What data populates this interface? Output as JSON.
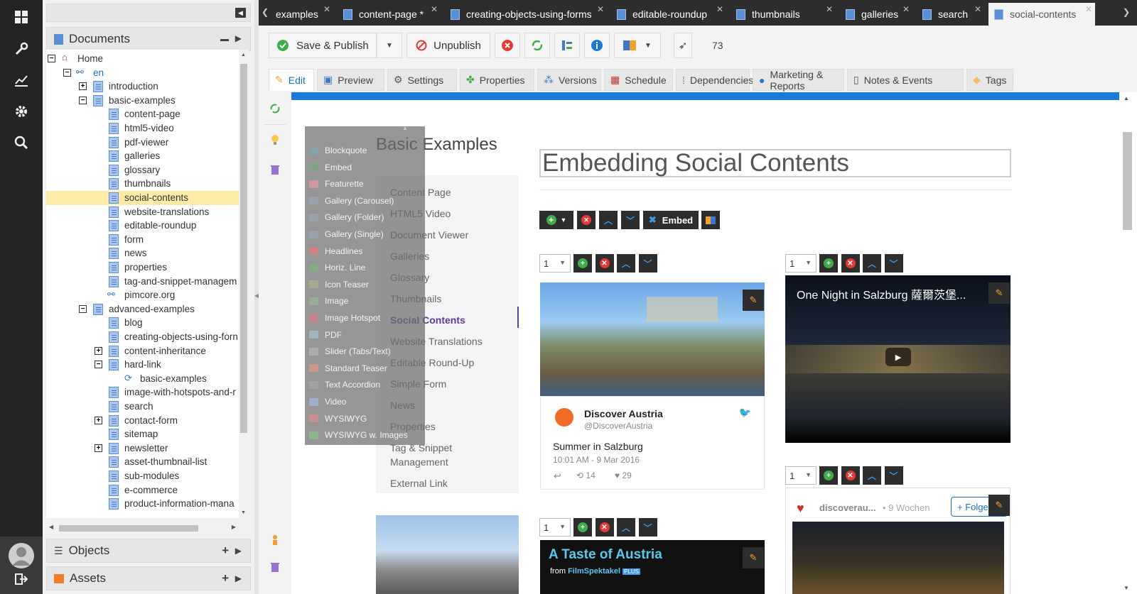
{
  "nav": {
    "icons": [
      "grid-icon",
      "wrench-icon",
      "chart-icon",
      "gear-icon",
      "search-icon",
      "user-avatar-icon",
      "logout-icon"
    ]
  },
  "documents_panel": {
    "title": "Documents"
  },
  "objects_panel": {
    "title": "Objects"
  },
  "assets_panel": {
    "title": "Assets"
  },
  "tree": [
    {
      "label": "Home",
      "level": 0,
      "expander": "minus",
      "icon": "home"
    },
    {
      "label": "en",
      "level": 1,
      "expander": "minus",
      "icon": "link"
    },
    {
      "label": "introduction",
      "level": 2,
      "expander": "plus",
      "icon": "doc"
    },
    {
      "label": "basic-examples",
      "level": 2,
      "expander": "minus",
      "icon": "doc"
    },
    {
      "label": "content-page",
      "level": 3,
      "icon": "doc"
    },
    {
      "label": "html5-video",
      "level": 3,
      "icon": "doc"
    },
    {
      "label": "pdf-viewer",
      "level": 3,
      "icon": "doc"
    },
    {
      "label": "galleries",
      "level": 3,
      "icon": "doc"
    },
    {
      "label": "glossary",
      "level": 3,
      "icon": "doc"
    },
    {
      "label": "thumbnails",
      "level": 3,
      "icon": "doc"
    },
    {
      "label": "social-contents",
      "level": 3,
      "icon": "doc",
      "selected": true
    },
    {
      "label": "website-translations",
      "level": 3,
      "icon": "doc"
    },
    {
      "label": "editable-roundup",
      "level": 3,
      "icon": "doc"
    },
    {
      "label": "form",
      "level": 3,
      "icon": "doc"
    },
    {
      "label": "news",
      "level": 3,
      "icon": "doc"
    },
    {
      "label": "properties",
      "level": 3,
      "icon": "doc"
    },
    {
      "label": "tag-and-snippet-managem",
      "level": 3,
      "icon": "doc"
    },
    {
      "label": "pimcore.org",
      "level": 3,
      "icon": "link"
    },
    {
      "label": "advanced-examples",
      "level": 2,
      "expander": "minus",
      "icon": "doc"
    },
    {
      "label": "blog",
      "level": 3,
      "icon": "doc"
    },
    {
      "label": "creating-objects-using-forn",
      "level": 3,
      "icon": "doc"
    },
    {
      "label": "content-inheritance",
      "level": 3,
      "expander": "plus",
      "icon": "doc"
    },
    {
      "label": "hard-link",
      "level": 3,
      "expander": "minus",
      "icon": "doc"
    },
    {
      "label": "basic-examples",
      "level": 4,
      "icon": "hardlink"
    },
    {
      "label": "image-with-hotspots-and-r",
      "level": 3,
      "icon": "doc"
    },
    {
      "label": "search",
      "level": 3,
      "icon": "doc"
    },
    {
      "label": "contact-form",
      "level": 3,
      "expander": "plus",
      "icon": "doc"
    },
    {
      "label": "sitemap",
      "level": 3,
      "icon": "doc"
    },
    {
      "label": "newsletter",
      "level": 3,
      "expander": "plus",
      "icon": "doc"
    },
    {
      "label": "asset-thumbnail-list",
      "level": 3,
      "icon": "doc"
    },
    {
      "label": "sub-modules",
      "level": 3,
      "icon": "doc"
    },
    {
      "label": "e-commerce",
      "level": 3,
      "icon": "doc"
    },
    {
      "label": "product-information-mana",
      "level": 3,
      "icon": "doc"
    }
  ],
  "tabs": [
    {
      "label": "examples",
      "active": false
    },
    {
      "label": "content-page *",
      "active": false
    },
    {
      "label": "creating-objects-using-forms",
      "active": false
    },
    {
      "label": "editable-roundup",
      "active": false
    },
    {
      "label": "thumbnails",
      "active": false
    },
    {
      "label": "galleries",
      "active": false
    },
    {
      "label": "search",
      "active": false
    },
    {
      "label": "social-contents",
      "active": true
    }
  ],
  "toolbar": {
    "save_publish": "Save & Publish",
    "unpublish": "Unpublish",
    "count": "73"
  },
  "edit_tabs": [
    {
      "label": "Edit",
      "icon": "pencil-icon",
      "active": true
    },
    {
      "label": "Preview",
      "icon": "preview-icon"
    },
    {
      "label": "Settings",
      "icon": "settings-icon"
    },
    {
      "label": "Properties",
      "icon": "properties-icon"
    },
    {
      "label": "Versions",
      "icon": "versions-icon"
    },
    {
      "label": "Schedule",
      "icon": "schedule-icon"
    },
    {
      "label": "Dependencies",
      "icon": "dependencies-icon"
    },
    {
      "label": "Marketing & Reports",
      "icon": "marketing-icon"
    },
    {
      "label": "Notes & Events",
      "icon": "notes-icon"
    },
    {
      "label": "Tags",
      "icon": "tag-icon"
    }
  ],
  "page": {
    "sidebar_title": "Basic Examples",
    "heading": "Embedding Social Contents",
    "embed_button": "Embed",
    "menu": [
      {
        "label": "Content Page"
      },
      {
        "label": "HTML5 Video"
      },
      {
        "label": "Document Viewer"
      },
      {
        "label": "Galleries"
      },
      {
        "label": "Glossary"
      },
      {
        "label": "Thumbnails"
      },
      {
        "label": "Social Contents",
        "active": true
      },
      {
        "label": "Website Translations"
      },
      {
        "label": "Editable Round-Up"
      },
      {
        "label": "Simple Form"
      },
      {
        "label": "News"
      },
      {
        "label": "Properties"
      },
      {
        "label": "Tag & Snippet"
      },
      {
        "label": "Management"
      },
      {
        "label": "External Link"
      }
    ],
    "block_menu": [
      "Blockquote",
      "Embed",
      "Featurette",
      "Gallery (Carousel)",
      "Gallery (Folder)",
      "Gallery (Single)",
      "Headlines",
      "Horiz. Line",
      "Icon Teaser",
      "Image",
      "Image Hotspot",
      "PDF",
      "Slider (Tabs/Text)",
      "Standard Teaser",
      "Text Accordion",
      "Video",
      "WYSIWYG",
      "WYSIWYG w. Images"
    ],
    "select_value": "1",
    "tweet": {
      "name": "Discover Austria",
      "handle": "@DiscoverAustria",
      "text": "Summer in Salzburg",
      "time": "10:01 AM - 9 Mar 2016",
      "retweets": "14",
      "likes": "29"
    },
    "video": {
      "title": "One Night in Salzburg 薩爾茨堡..."
    },
    "instagram": {
      "user": "discoverau...",
      "time": "9 Wochen",
      "follow": "+ Folge"
    },
    "taste": {
      "title": "A Taste of Austria",
      "from": "from",
      "brand": "FilmSpektakel",
      "badge": "PLUS"
    }
  }
}
